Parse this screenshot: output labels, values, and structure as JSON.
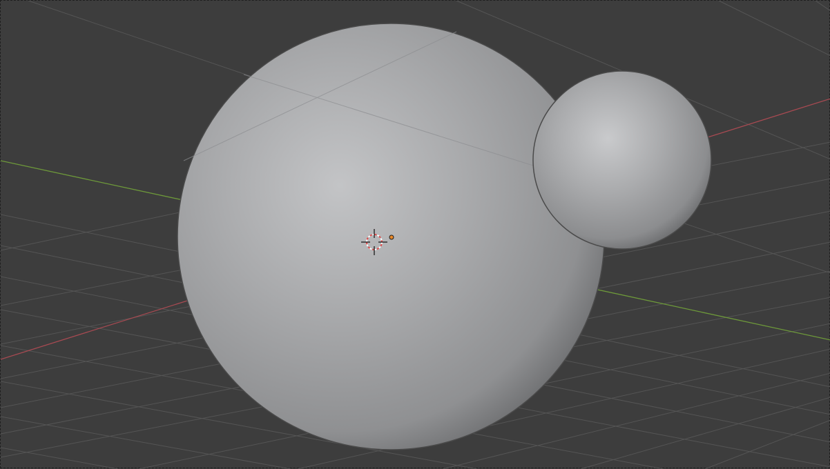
{
  "viewport": {
    "background_color": "#3d3d3d",
    "grid_color": "#555555",
    "x_axis_color": "#a84a52",
    "y_axis_color": "#6e9a3a",
    "object_color": "#9a9b9d",
    "origin_color": "#e8892a",
    "cursor_colors": [
      "#ffffff",
      "#e04a4a"
    ]
  },
  "scene": {
    "objects": [
      {
        "name": "large-sphere",
        "shape": "uv-sphere"
      },
      {
        "name": "small-sphere",
        "shape": "uv-sphere"
      }
    ],
    "cursor": "3d-cursor-icon",
    "origin": "object-origin-icon"
  }
}
